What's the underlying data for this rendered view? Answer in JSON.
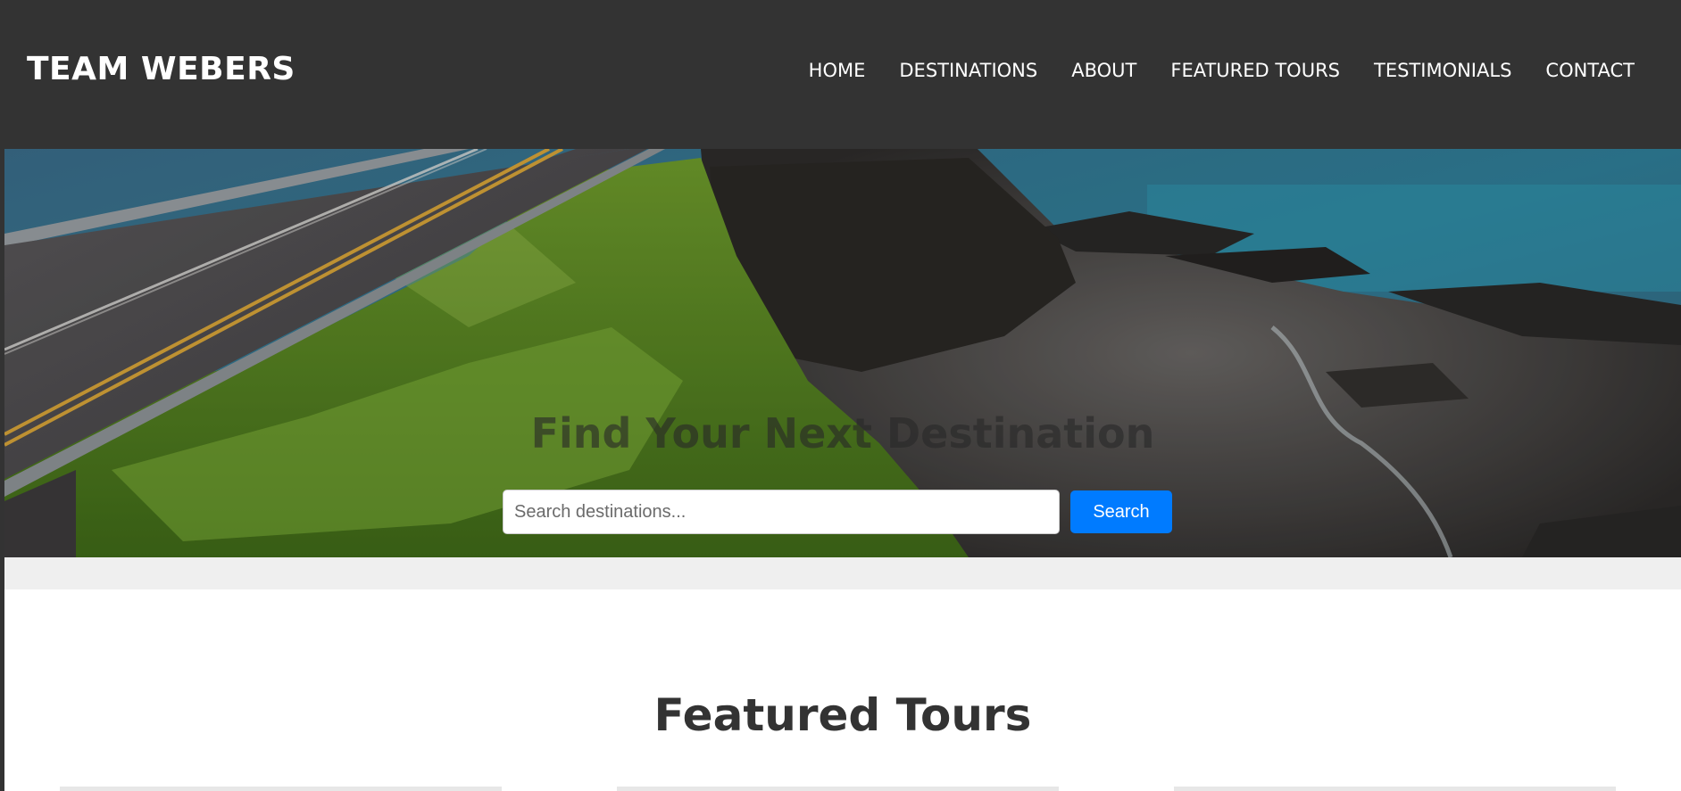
{
  "header": {
    "brand": "TEAM WEBERS",
    "nav": [
      {
        "label": "HOME"
      },
      {
        "label": "DESTINATIONS"
      },
      {
        "label": "ABOUT"
      },
      {
        "label": "FEATURED TOURS"
      },
      {
        "label": "TESTIMONIALS"
      },
      {
        "label": "CONTACT"
      }
    ]
  },
  "hero": {
    "title": "Find Your Next Destination",
    "search": {
      "placeholder": "Search destinations...",
      "value": "",
      "button_label": "Search"
    }
  },
  "featured": {
    "title": "Featured Tours"
  },
  "colors": {
    "header_bg": "#333333",
    "accent": "#007bff",
    "band": "#efefef"
  }
}
